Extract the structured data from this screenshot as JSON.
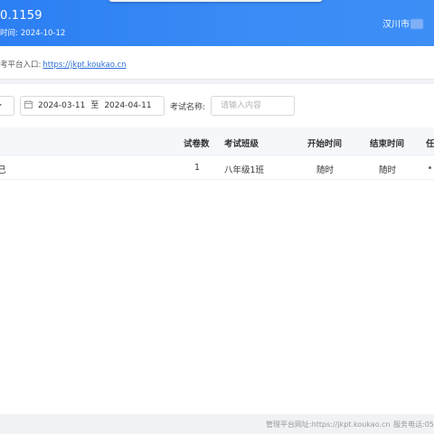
{
  "header": {
    "version": "0.1159",
    "time_label": "时间:",
    "time_value": "2024-10-12",
    "user_name": "汉川市"
  },
  "info_bar": {
    "portal_label": "考平台入口:",
    "portal_link": "https://jkpt.koukao.cn"
  },
  "filters": {
    "date_start": "2024-03-11",
    "date_separator": "至",
    "date_end": "2024-04-11",
    "exam_name_label": "考试名称:",
    "exam_name_placeholder": "请输入内容",
    "calendar_icon": "calendar-icon",
    "dropdown_icon": "chevron-down-icon"
  },
  "table": {
    "columns": [
      "试卷数",
      "考试班级",
      "开始时间",
      "结束时间",
      "任"
    ],
    "rows": [
      {
        "name_fragment": "己",
        "paper_count": "1",
        "exam_class": "八年级1班",
        "start_time": "随时",
        "end_time": "随时",
        "task": "•"
      }
    ]
  },
  "footer": {
    "site_text": "管理平台网址:https://jkpt.koukao.cn",
    "phone_text": "服务电话:05"
  },
  "colors": {
    "header_blue": "#2c7ff2",
    "link_blue": "#2d6fd9",
    "background": "#f0f2f5"
  }
}
